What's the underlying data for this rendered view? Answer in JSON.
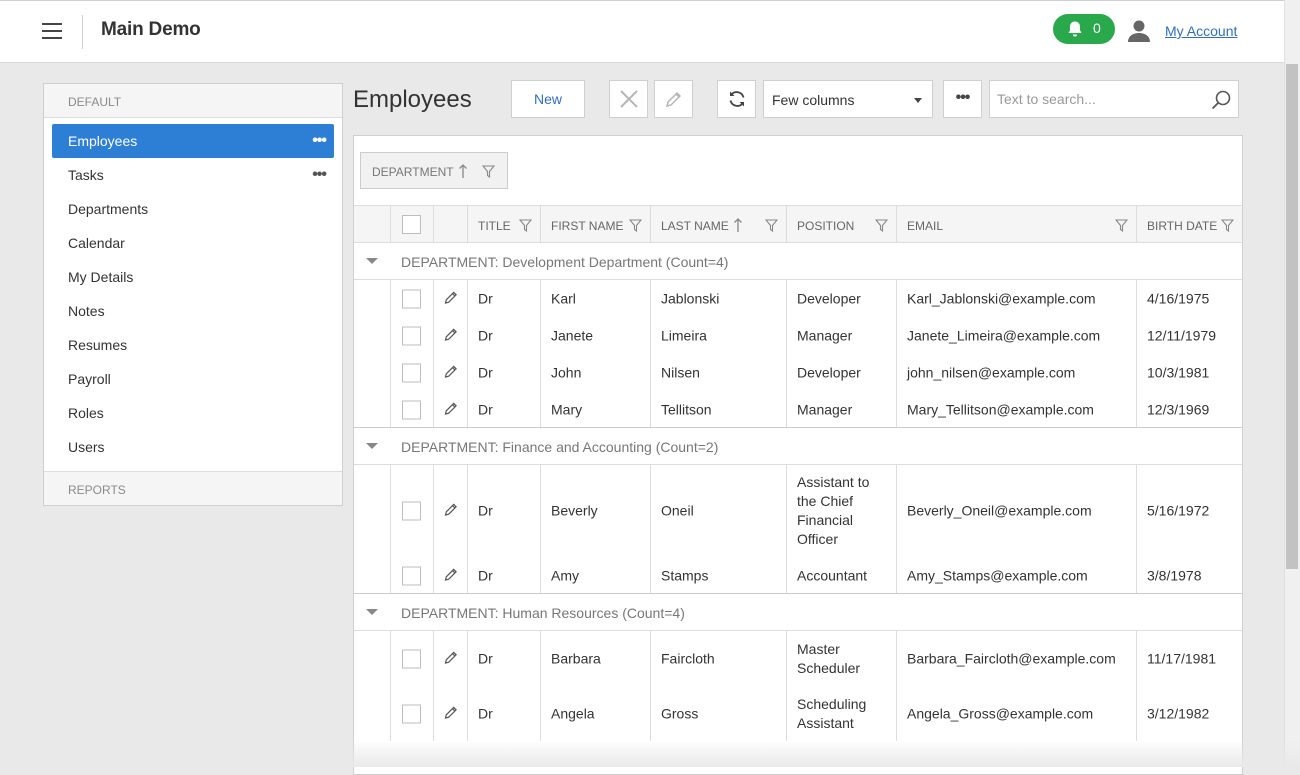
{
  "header": {
    "app_title": "Main Demo",
    "notification_count": "0",
    "account_link": "My Account"
  },
  "sidebar": {
    "section_default": "DEFAULT",
    "section_reports": "REPORTS",
    "active_item": "Employees",
    "items": [
      {
        "label": "Employees",
        "has_menu": true
      },
      {
        "label": "Tasks",
        "has_menu": true
      },
      {
        "label": "Departments",
        "has_menu": false
      },
      {
        "label": "Calendar",
        "has_menu": false
      },
      {
        "label": "My Details",
        "has_menu": false
      },
      {
        "label": "Notes",
        "has_menu": false
      },
      {
        "label": "Resumes",
        "has_menu": false
      },
      {
        "label": "Payroll",
        "has_menu": false
      },
      {
        "label": "Roles",
        "has_menu": false
      },
      {
        "label": "Users",
        "has_menu": false
      }
    ],
    "menu_glyph": "•••"
  },
  "toolbar": {
    "page_title": "Employees",
    "new_label": "New",
    "view_select": "Few columns",
    "more_glyph": "•••",
    "search_placeholder": "Text to search..."
  },
  "grid": {
    "group_chip": "DEPARTMENT",
    "columns": {
      "title": "TITLE",
      "first_name": "FIRST NAME",
      "last_name": "LAST NAME",
      "position": "POSITION",
      "email": "EMAIL",
      "birth_date": "BIRTH DATE"
    },
    "groups": [
      {
        "label": "DEPARTMENT: Development Department (Count=4)",
        "rows": [
          {
            "title": "Dr",
            "first": "Karl",
            "last": "Jablonski",
            "position": "Developer",
            "email": "Karl_Jablonski@example.com",
            "birth": "4/16/1975"
          },
          {
            "title": "Dr",
            "first": "Janete",
            "last": "Limeira",
            "position": "Manager",
            "email": "Janete_Limeira@example.com",
            "birth": "12/11/1979"
          },
          {
            "title": "Dr",
            "first": "John",
            "last": "Nilsen",
            "position": "Developer",
            "email": "john_nilsen@example.com",
            "birth": "10/3/1981"
          },
          {
            "title": "Dr",
            "first": "Mary",
            "last": "Tellitson",
            "position": "Manager",
            "email": "Mary_Tellitson@example.com",
            "birth": "12/3/1969"
          }
        ]
      },
      {
        "label": "DEPARTMENT: Finance and Accounting (Count=2)",
        "rows": [
          {
            "title": "Dr",
            "first": "Beverly",
            "last": "Oneil",
            "position": "Assistant to the Chief Financial Officer",
            "email": "Beverly_Oneil@example.com",
            "birth": "5/16/1972"
          },
          {
            "title": "Dr",
            "first": "Amy",
            "last": "Stamps",
            "position": "Accountant",
            "email": "Amy_Stamps@example.com",
            "birth": "3/8/1978"
          }
        ]
      },
      {
        "label": "DEPARTMENT: Human Resources (Count=4)",
        "rows": [
          {
            "title": "Dr",
            "first": "Barbara",
            "last": "Faircloth",
            "position": "Master Scheduler",
            "email": "Barbara_Faircloth@example.com",
            "birth": "11/17/1981"
          },
          {
            "title": "Dr",
            "first": "Angela",
            "last": "Gross",
            "position": "Scheduling Assistant",
            "email": "Angela_Gross@example.com",
            "birth": "3/12/1982"
          }
        ]
      }
    ]
  },
  "colors": {
    "accent": "#2d7fd6",
    "notification": "#2aa84c",
    "link": "#2f6fc3"
  },
  "icons": [
    "hamburger-icon",
    "bell-icon",
    "user-icon",
    "close-icon",
    "pencil-icon",
    "refresh-icon",
    "search-icon",
    "filter-icon",
    "sort-up-icon",
    "expand-icon"
  ]
}
